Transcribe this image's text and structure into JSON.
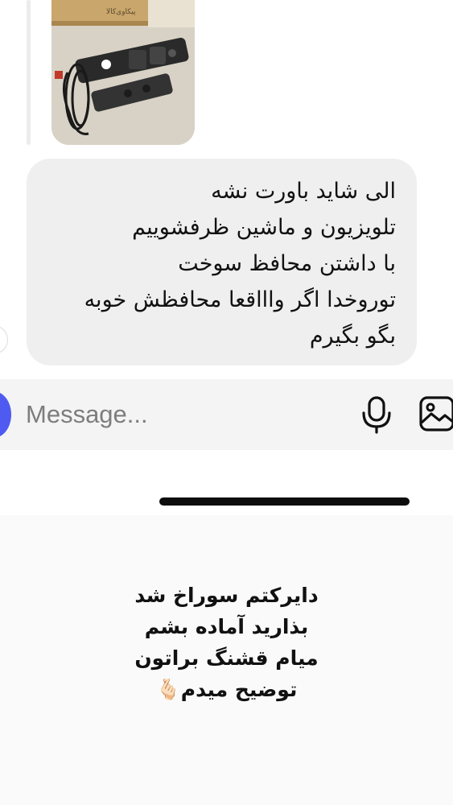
{
  "chat": {
    "photo": {
      "label_text": "پیکاوی‌کالا"
    },
    "message_lines": [
      "الی شاید باورت نشه",
      "تلویزیون و ماشین ظرفشوییم",
      "با داشتن محافظ سوخت",
      "توروخدا اگر واااقعا محافظش خوبه",
      "بگو بگیرم"
    ]
  },
  "composer": {
    "placeholder": "Message...",
    "icons": [
      "camera-icon",
      "microphone-icon",
      "gallery-icon"
    ]
  },
  "caption": {
    "lines": [
      "دایرکتم سوراخ شد",
      "بذارید آماده بشم",
      "میام قشنگ براتون",
      "توضیح میدم🫰🏻"
    ]
  },
  "colors": {
    "bubble": "#efefef",
    "composer": "#f4f4f4",
    "accent": "#4f5bf0",
    "caption_background": "#fafafa"
  }
}
